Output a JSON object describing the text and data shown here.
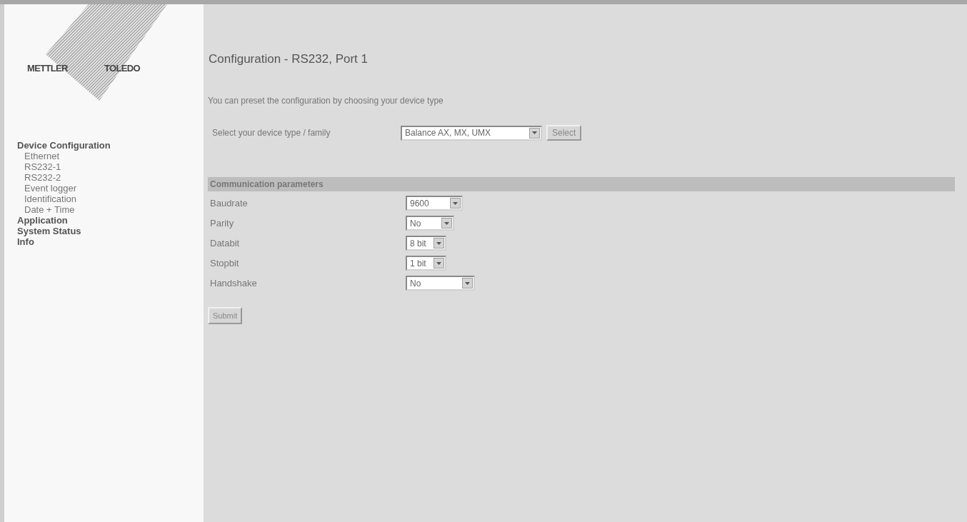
{
  "logo": {
    "left": "METTLER",
    "right": "TOLEDO"
  },
  "nav": [
    {
      "label": "Device Configuration",
      "children": [
        {
          "label": "Ethernet"
        },
        {
          "label": "RS232-1"
        },
        {
          "label": "RS232-2"
        },
        {
          "label": "Event logger"
        },
        {
          "label": "Identification"
        },
        {
          "label": "Date + Time"
        }
      ]
    },
    {
      "label": "Application"
    },
    {
      "label": "System Status"
    },
    {
      "label": "Info"
    }
  ],
  "title": "Configuration - RS232, Port 1",
  "description": "You can preset the configuration by choosing your device type",
  "device_type": {
    "label": "Select your device type / family",
    "value": "Balance AX, MX, UMX",
    "button": "Select"
  },
  "section_title": "Communication parameters",
  "parameters": [
    {
      "label": "Baudrate",
      "value": "9600"
    },
    {
      "label": "Parity",
      "value": "No"
    },
    {
      "label": "Databit",
      "value": "8 bit"
    },
    {
      "label": "Stopbit",
      "value": "1 bit"
    },
    {
      "label": "Handshake",
      "value": "No"
    }
  ],
  "submit": "Submit"
}
